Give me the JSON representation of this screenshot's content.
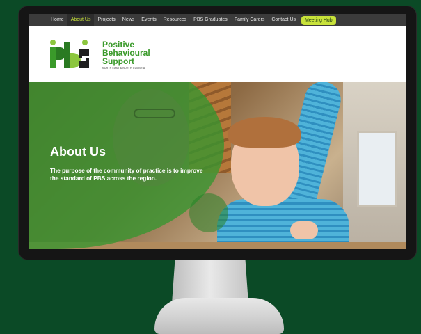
{
  "nav": {
    "items": [
      {
        "label": "Home"
      },
      {
        "label": "About Us",
        "active": true
      },
      {
        "label": "Projects"
      },
      {
        "label": "News"
      },
      {
        "label": "Events"
      },
      {
        "label": "Resources"
      },
      {
        "label": "PBS Graduates"
      },
      {
        "label": "Family Carers"
      },
      {
        "label": "Contact Us"
      }
    ],
    "hub_label": "Meeting Hub"
  },
  "brand": {
    "logo_mark": "pbs",
    "title_line1": "Positive",
    "title_line2": "Behavioural",
    "title_line3": "Support",
    "subtitle": "NORTH EAST & NORTH CUMBRIA"
  },
  "hero": {
    "title": "About Us",
    "text": "The purpose of the community of practice is to improve the standard of PBS across the region."
  },
  "colors": {
    "page_bg": "#0b4a26",
    "nav_bg": "#3b3b3b",
    "accent_lime": "#c8e23a",
    "brand_green": "#3a9a2a",
    "overlay_green": "#369630"
  }
}
